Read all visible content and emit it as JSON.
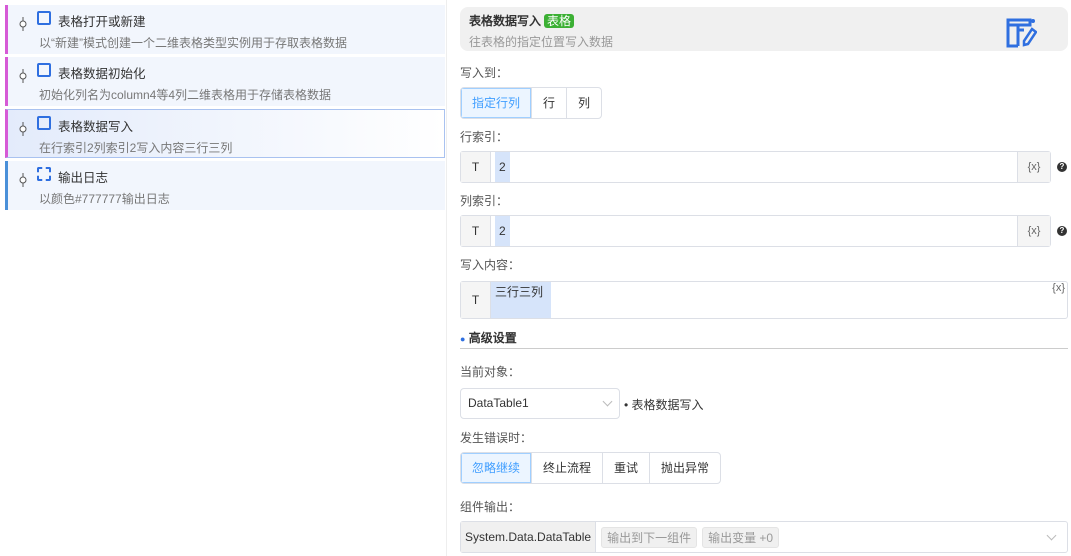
{
  "flow": [
    {
      "title": "表格打开或新建",
      "desc": "以“新建”模式创建一个二维表格类型实例用于存取表格数据"
    },
    {
      "title": "表格数据初始化",
      "desc": "初始化列名为column4等4列二维表格用于存储表格数据"
    },
    {
      "title": "表格数据写入",
      "desc": "在行索引2列索引2写入内容三行三列"
    },
    {
      "title": "输出日志",
      "desc": "以颜色#777777输出日志"
    }
  ],
  "header": {
    "title": "表格数据写入",
    "badge": "表格",
    "desc": "往表格的指定位置写入数据"
  },
  "write_to": {
    "label": "写入到：",
    "options": [
      "指定行列",
      "行",
      "列"
    ]
  },
  "row_index": {
    "label": "行索引：",
    "type": "T",
    "value": "2",
    "var": "{x}"
  },
  "col_index": {
    "label": "列索引：",
    "type": "T",
    "value": "2",
    "var": "{x}"
  },
  "content": {
    "label": "写入内容：",
    "type": "T",
    "value": "三行三列",
    "var": "{x}"
  },
  "advanced": {
    "title": "高级设置"
  },
  "current_object": {
    "label": "当前对象：",
    "value": "DataTable1",
    "note": "• 表格数据写入"
  },
  "on_error": {
    "label": "发生错误时：",
    "options": [
      "忽略继续",
      "终止流程",
      "重试",
      "抛出异常"
    ]
  },
  "output": {
    "label": "组件输出：",
    "type": "System.Data.DataTable",
    "tags": [
      "输出到下一组件",
      "输出变量 +0"
    ]
  },
  "help": "?"
}
